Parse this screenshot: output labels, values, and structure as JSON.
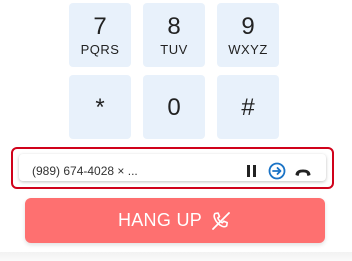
{
  "keypad": [
    {
      "digit": "7",
      "letters": "PQRS"
    },
    {
      "digit": "8",
      "letters": "TUV"
    },
    {
      "digit": "9",
      "letters": "WXYZ"
    },
    {
      "digit": "*",
      "letters": ""
    },
    {
      "digit": "0",
      "letters": ""
    },
    {
      "digit": "#",
      "letters": ""
    }
  ],
  "call": {
    "number": "(989) 674-4028 × ...",
    "icons": [
      "pause-icon",
      "transfer-icon",
      "hangup-phone-icon"
    ],
    "accent_color": "#d0021b",
    "transfer_color": "#1a73c6"
  },
  "hangup_button": {
    "label": "HANG UP",
    "icon": "phone-off-icon",
    "color": "#fe7070"
  }
}
